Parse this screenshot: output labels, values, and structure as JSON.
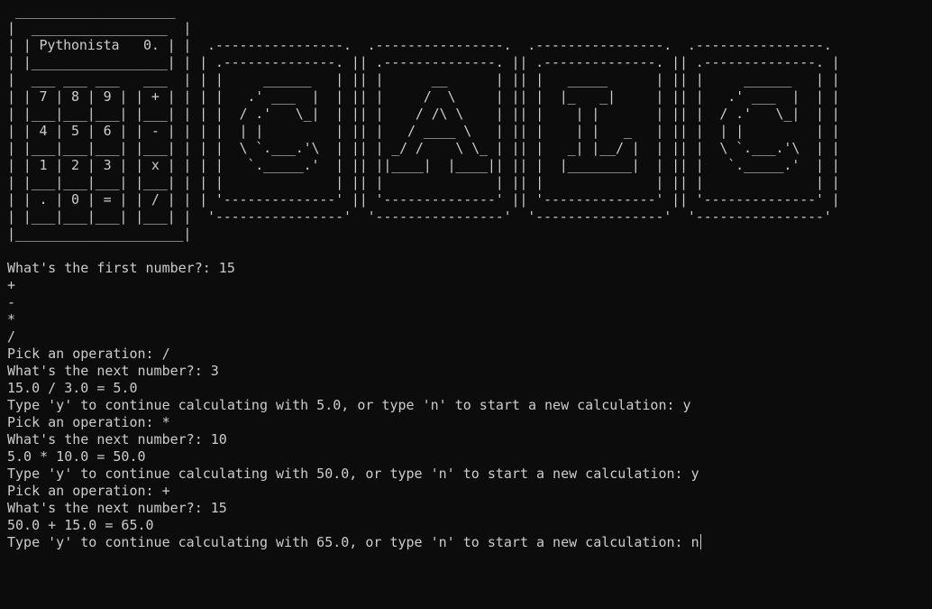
{
  "terminal": {
    "banner_lines": [
      " ____________________",
      "|  _________________  |",
      "| | Pythonista   0. | |  .----------------.  .----------------.  .----------------.  .----------------.",
      "| |_________________| | | .--------------. || .--------------. || .--------------. || .--------------. |",
      "|  ___ ___ ___   ___  | | |     ______   | || |      __      | || |   _____      | || |     ______   | |",
      "| | 7 | 8 | 9 | | + | | | |   .' ___  |  | || |     /  \\     | || |  |_   _|     | || |   .' ___  |  | |",
      "| |___|___|___| |___| | | |  / .'   \\_|  | || |    / /\\ \\    | || |    | |       | || |  / .'   \\_|  | |",
      "| | 4 | 5 | 6 | | - | | | |  | |         | || |   / ____ \\   | || |    | |   _   | || |  | |         | |",
      "| |___|___|___| |___| | | |  \\ `.___.'\\  | || | _/ /    \\ \\_ | || |   _| |__/ |  | || |  \\ `.___.'\\  | |",
      "| | 1 | 2 | 3 | | x | | | |   `._____.'  | || ||____|  |____|| || |  |________|  | || |   `._____.'  | |",
      "| |___|___|___| |___| | | |              | || |              | || |              | || |              | |",
      "| | . | 0 | = | | / | | | '--------------' || '--------------' || '--------------' || '--------------' |",
      "| |___|___|___| |___| |  '----------------'  '----------------'  '----------------'  '----------------'",
      "|_____________________|"
    ],
    "transcript_lines": [
      "What's the first number?: 15",
      "+",
      "-",
      "*",
      "/",
      "Pick an operation: /",
      "What's the next number?: 3",
      "15.0 / 3.0 = 5.0",
      "Type 'y' to continue calculating with 5.0, or type 'n' to start a new calculation: y",
      "Pick an operation: *",
      "What's the next number?: 10",
      "5.0 * 10.0 = 50.0",
      "Type 'y' to continue calculating with 50.0, or type 'n' to start a new calculation: y",
      "Pick an operation: +",
      "What's the next number?: 15",
      "50.0 + 15.0 = 65.0"
    ],
    "current_prompt": "Type 'y' to continue calculating with 65.0, or type 'n' to start a new calculation: ",
    "current_input": "n",
    "colors": {
      "background": "#0c0c0c",
      "foreground": "#cccccc"
    }
  }
}
